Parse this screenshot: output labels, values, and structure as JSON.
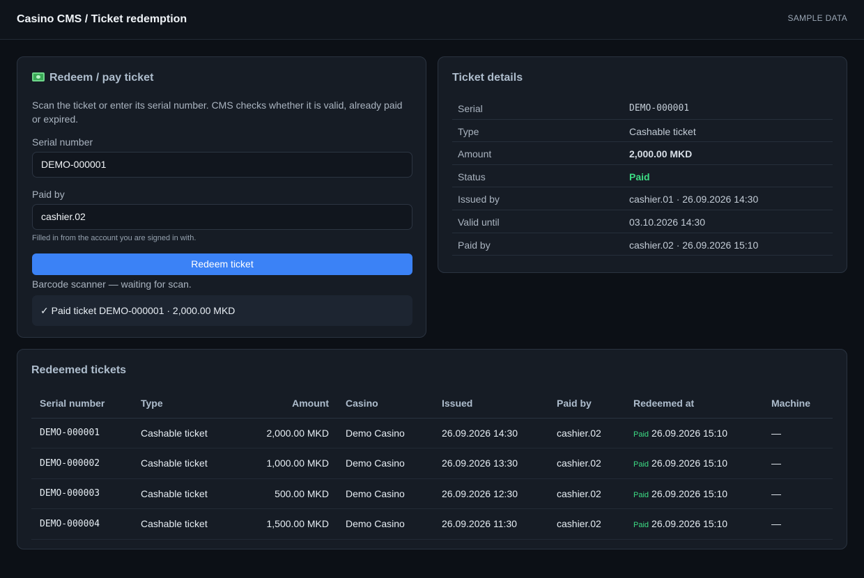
{
  "header": {
    "title": "Casino CMS / Ticket redemption",
    "badge": "SAMPLE DATA"
  },
  "redeem": {
    "title": "Redeem / pay ticket",
    "icon": "money-icon",
    "description": "Scan the ticket or enter its serial number. CMS checks whether it is valid, already paid or expired.",
    "serial_label": "Serial number",
    "serial_value": "DEMO-000001",
    "paid_by_label": "Paid by",
    "paid_by_value": "cashier.02",
    "paid_by_hint": "Filled in from the account you are signed in with.",
    "button_label": "Redeem ticket",
    "scanner_status": "Barcode scanner — waiting for scan.",
    "result_message": "✓ Paid ticket DEMO-000001 · 2,000.00 MKD"
  },
  "details": {
    "title": "Ticket details",
    "rows": [
      {
        "label": "Serial",
        "value": "DEMO-000001"
      },
      {
        "label": "Type",
        "value": "Cashable ticket"
      },
      {
        "label": "Amount",
        "value": "2,000.00 MKD"
      },
      {
        "label": "Status",
        "value": "Paid"
      },
      {
        "label": "Issued by",
        "value": "cashier.01 · 26.09.2026 14:30"
      },
      {
        "label": "Valid until",
        "value": "03.10.2026 14:30"
      },
      {
        "label": "Paid by",
        "value": "cashier.02 · 26.09.2026 15:10"
      }
    ]
  },
  "redeemed": {
    "title": "Redeemed tickets",
    "columns": [
      "Serial number",
      "Type",
      "Amount",
      "Casino",
      "Issued",
      "Paid by",
      "Redeemed at",
      "Machine"
    ],
    "rows": [
      {
        "serial": "DEMO-000001",
        "type": "Cashable ticket",
        "amount": "2,000.00 MKD",
        "casino": "Demo Casino",
        "issued": "26.09.2026 14:30",
        "paid_by": "cashier.02",
        "tag": "Paid",
        "redeemed_at": "26.09.2026 15:10",
        "machine": "—"
      },
      {
        "serial": "DEMO-000002",
        "type": "Cashable ticket",
        "amount": "1,000.00 MKD",
        "casino": "Demo Casino",
        "issued": "26.09.2026 13:30",
        "paid_by": "cashier.02",
        "tag": "Paid",
        "redeemed_at": "26.09.2026 15:10",
        "machine": "—"
      },
      {
        "serial": "DEMO-000003",
        "type": "Cashable ticket",
        "amount": "500.00 MKD",
        "casino": "Demo Casino",
        "issued": "26.09.2026 12:30",
        "paid_by": "cashier.02",
        "tag": "Paid",
        "redeemed_at": "26.09.2026 15:10",
        "machine": "—"
      },
      {
        "serial": "DEMO-000004",
        "type": "Cashable ticket",
        "amount": "1,500.00 MKD",
        "casino": "Demo Casino",
        "issued": "26.09.2026 11:30",
        "paid_by": "cashier.02",
        "tag": "Paid",
        "redeemed_at": "26.09.2026 15:10",
        "machine": "—"
      }
    ]
  },
  "colors": {
    "accent": "#3b82f6",
    "paid": "#3ddc84",
    "background": "#0c1016",
    "card": "#161c25"
  }
}
